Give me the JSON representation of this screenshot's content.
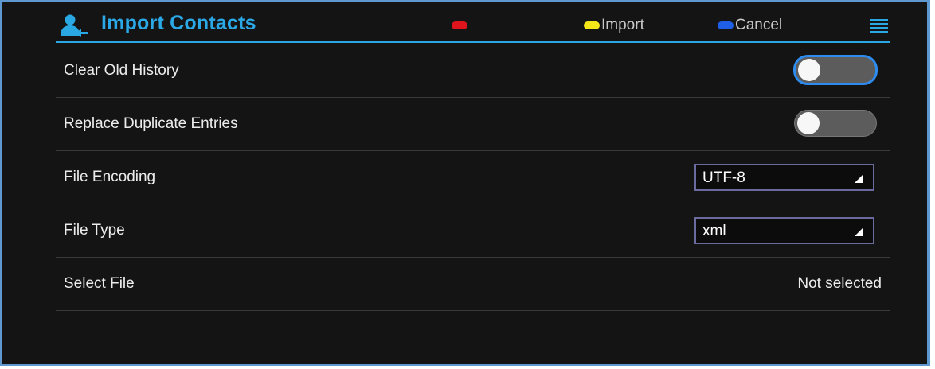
{
  "header": {
    "title": "Import Contacts",
    "title_icon": "contacts-import-icon",
    "softkeys": [
      {
        "color": "#e0141c",
        "label": ""
      },
      {
        "color": "#f5e61a",
        "label": "Import"
      },
      {
        "color": "#1f5fe8",
        "label": "Cancel"
      }
    ],
    "menu_icon": "menu-icon"
  },
  "settings": {
    "clear_old_history": {
      "label": "Clear Old History",
      "enabled": false
    },
    "replace_duplicates": {
      "label": "Replace Duplicate Entries",
      "enabled": false
    },
    "file_encoding": {
      "label": "File Encoding",
      "value": "UTF-8"
    },
    "file_type": {
      "label": "File Type",
      "value": "xml"
    },
    "select_file": {
      "label": "Select File",
      "value": "Not selected"
    }
  },
  "colors": {
    "accent": "#2aa8e4",
    "background": "#141414",
    "focus": "#2e8cf0"
  }
}
